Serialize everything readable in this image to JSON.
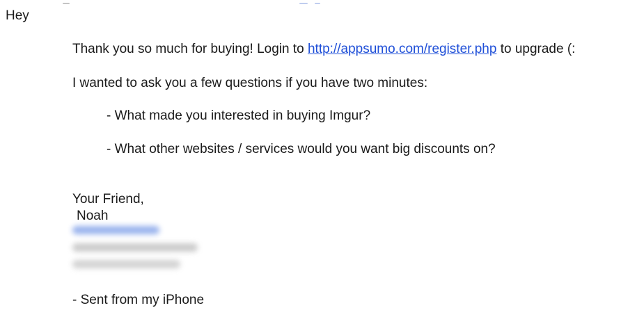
{
  "email": {
    "greeting": "Hey",
    "thanks_prefix": "Thank you so much for buying! Login to ",
    "link_text": "http://appsumo.com/register.php",
    "thanks_suffix": " to upgrade  (:",
    "ask": "I wanted to ask you a few questions if you have two minutes:",
    "questions": [
      "- What made you interested in buying Imgur?",
      "- What other websites / services would you want big discounts on?"
    ],
    "signoff": "Your Friend,",
    "name": "Noah",
    "sent_from": "- Sent from my iPhone"
  },
  "colors": {
    "link": "#1f4fd8",
    "text": "#1a1a1a",
    "blurred_phone": "#6f93e6",
    "blurred_text": "#b5b5b5"
  }
}
